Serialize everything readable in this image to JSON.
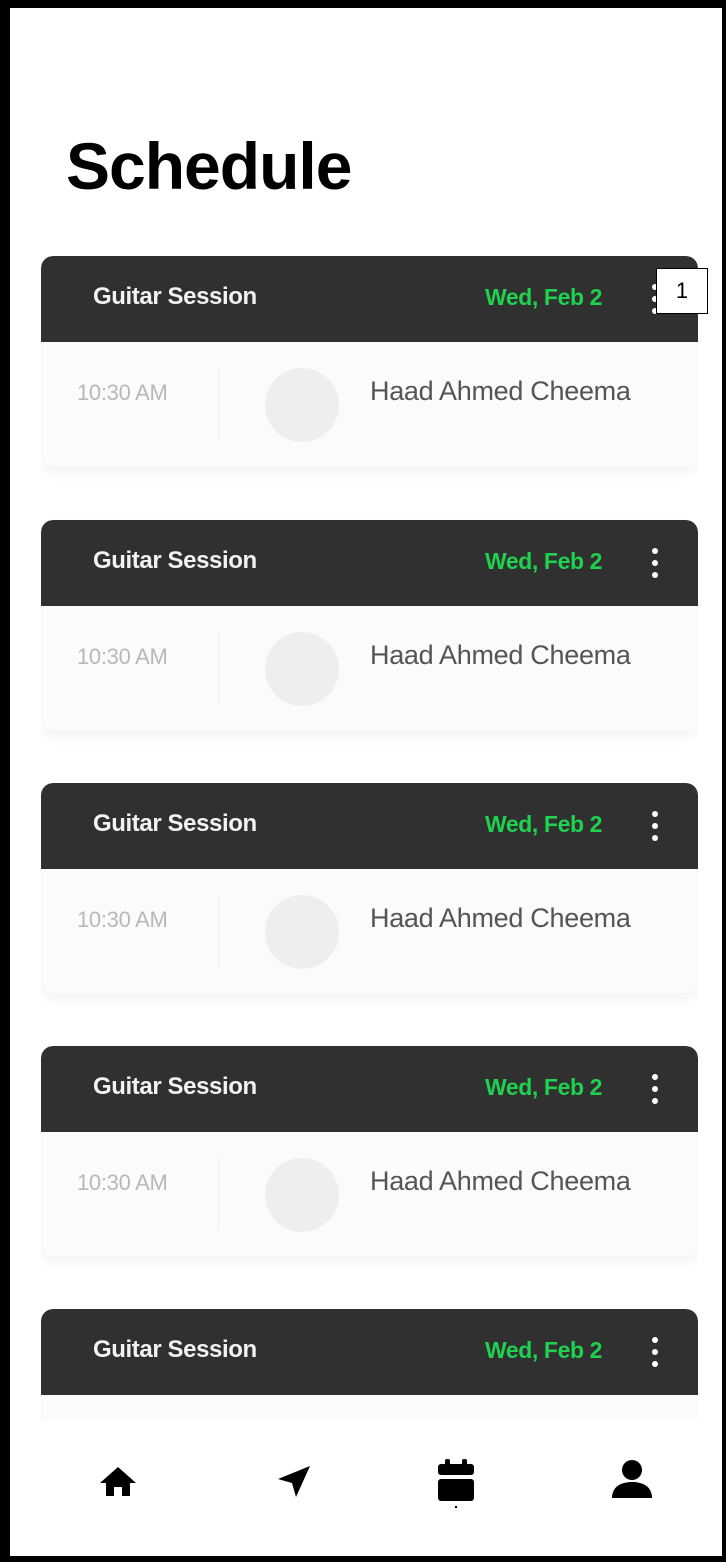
{
  "header": {
    "title": "Schedule"
  },
  "cards": [
    {
      "title": "Guitar Session",
      "date": "Wed, Feb 2",
      "time": "10:30 AM",
      "person": "Haad Ahmed Cheema"
    },
    {
      "title": "Guitar Session",
      "date": "Wed, Feb 2",
      "time": "10:30 AM",
      "person": "Haad Ahmed Cheema"
    },
    {
      "title": "Guitar Session",
      "date": "Wed, Feb 2",
      "time": "10:30 AM",
      "person": "Haad Ahmed Cheema"
    },
    {
      "title": "Guitar Session",
      "date": "Wed, Feb 2",
      "time": "10:30 AM",
      "person": "Haad Ahmed Cheema"
    },
    {
      "title": "Guitar Session",
      "date": "Wed, Feb 2",
      "time": "",
      "person": ""
    }
  ],
  "annotation": {
    "label": "1"
  },
  "nav": {
    "items": [
      {
        "icon": "home-icon"
      },
      {
        "icon": "send-icon"
      },
      {
        "icon": "calendar-icon",
        "active": true
      },
      {
        "icon": "profile-icon"
      }
    ]
  },
  "colors": {
    "card_header_bg": "#303030",
    "date_accent": "#1fd14f",
    "card_body_bg": "#fbfbfb"
  }
}
